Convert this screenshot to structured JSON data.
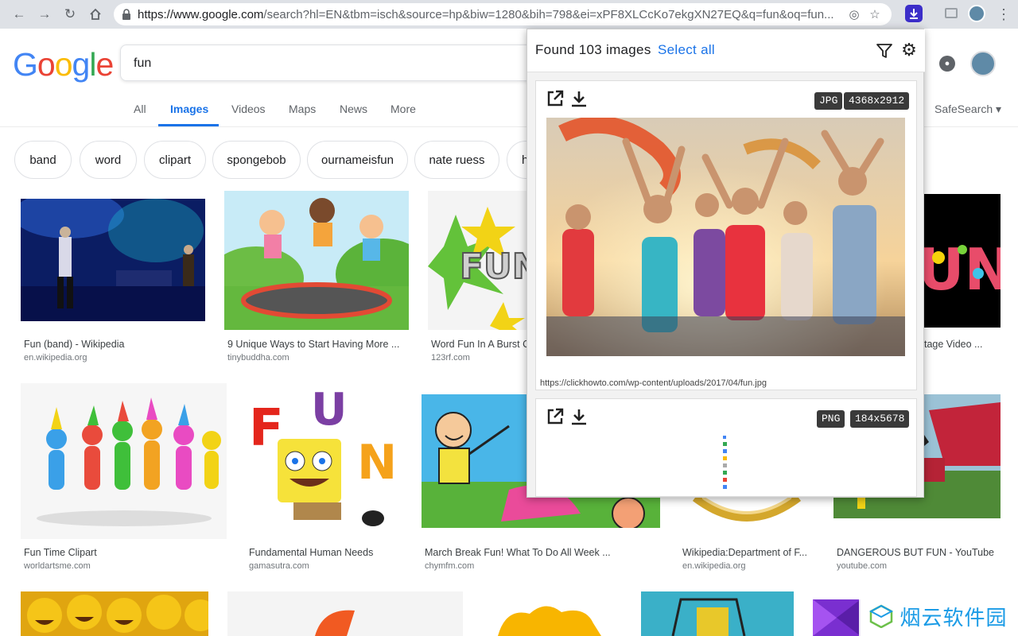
{
  "browser": {
    "url_host": "https://www.google.com",
    "url_rest": "/search?hl=EN&tbm=isch&source=hp&biw=1280&bih=798&ei=xPF8XLCcKo7ekgXN27EQ&q=fun&oq=fun..."
  },
  "google": {
    "logo": "Google",
    "query": "fun",
    "tabs": [
      "All",
      "Images",
      "Videos",
      "Maps",
      "News",
      "More"
    ],
    "active_tab": "Images",
    "safesearch": "SafeSearch ▾",
    "chips": [
      "band",
      "word",
      "clipart",
      "spongebob",
      "ournameisfun",
      "nate ruess",
      "h"
    ]
  },
  "results": [
    {
      "title": "Fun (band) - Wikipedia",
      "domain": "en.wikipedia.org"
    },
    {
      "title": "9 Unique Ways to Start Having More ...",
      "domain": "tinybuddha.com"
    },
    {
      "title": "Word Fun In A Burst C",
      "domain": "123rf.com"
    },
    {
      "title": "tage Video ...",
      "domain": ""
    },
    {
      "title": "Fun Time Clipart",
      "domain": "worldartsme.com"
    },
    {
      "title": "Fundamental Human Needs",
      "domain": "gamasutra.com"
    },
    {
      "title": "March Break Fun! What To Do All Week ...",
      "domain": "chymfm.com"
    },
    {
      "title": "Wikipedia:Department of F...",
      "domain": "en.wikipedia.org"
    },
    {
      "title": "DANGEROUS BUT FUN - YouTube",
      "domain": "youtube.com"
    }
  ],
  "thumb_labels": {
    "fun_word": "FUN",
    "burst_word": "FUN",
    "un_word": "UN",
    "letter_f": "F",
    "letter_u": "U",
    "letter_n": "N"
  },
  "popup": {
    "found": "Found 103 images",
    "select_all": "Select all",
    "cards": [
      {
        "format": "JPG",
        "size": "4368x2912",
        "url": "https://clickhowto.com/wp-content/uploads/2017/04/fun.jpg"
      },
      {
        "format": "PNG",
        "size": "184x5678"
      }
    ]
  },
  "watermark": "烟云软件园",
  "colors": {
    "google_blue": "#4285f4",
    "google_red": "#ea4335",
    "google_yellow": "#fbbc05",
    "google_green": "#34a853",
    "active_tab": "#1a73e8",
    "ext_icon": "#3c2ec9"
  }
}
